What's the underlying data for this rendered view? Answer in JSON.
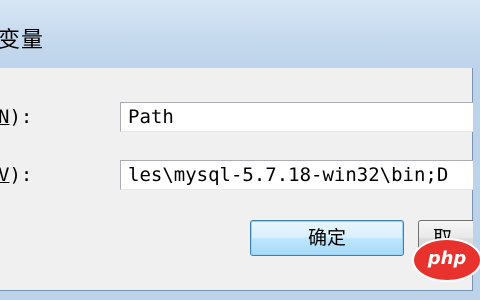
{
  "window": {
    "title": "变量"
  },
  "fields": {
    "name_label_suffix": "):",
    "name_label_mnemonic": "N",
    "name_value": "Path",
    "value_label_suffix": "):",
    "value_label_mnemonic": "V",
    "value_value": "les\\mysql-5.7.18-win32\\bin;D"
  },
  "buttons": {
    "ok_label": "确定",
    "cancel_label_partial": "取"
  },
  "watermark": {
    "text": "php"
  },
  "colors": {
    "title_bar": "#c9dcef",
    "client_bg": "#f0f0f0",
    "ok_border": "#3c7fb1",
    "php_logo": "#e8322e"
  },
  "icons": {
    "watermark_logo": "php-logo"
  }
}
